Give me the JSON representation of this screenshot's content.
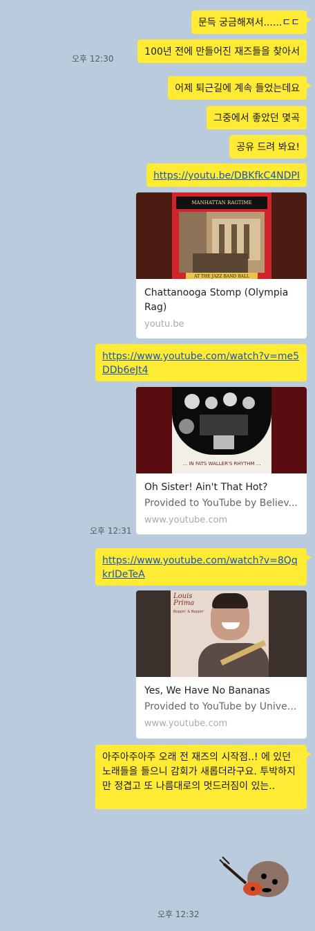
{
  "messages": {
    "m1": "문득 궁금해져서......ㄷㄷ",
    "m2": "100년 전에 만들어진 재즈들을 찾아서",
    "m3": "어제 퇴근길에 계속 들었는데요",
    "m4": "그중에서 좋았던 몇곡",
    "m5": "공유 드려 봐요!",
    "link1": "https://youtu.be/DBKfkC4NDPI",
    "link2": "https://www.youtube.com/watch?v=me5DDb6eJt4",
    "link3": "https://www.youtube.com/watch?v=8QqkrIDeTeA",
    "final": "아주아주아주 오래 전 재즈의 시작점..! 에 있던 노래들을 들으니 감회가 새롭더라구요. 투박하지만 정겹고 또 나름대로의 멋드러짐이 있는.."
  },
  "times": {
    "t1": "오후 12:30",
    "t2": "오후 12:31",
    "t3": "오후 12:32"
  },
  "cards": [
    {
      "thumb_text_top": "MANHATTAN RAGTIME ORCHESTRA",
      "thumb_text_bottom": "AT THE JAZZ BAND BALL",
      "title": "Chattanooga Stomp (Olympia Rag)",
      "domain": "youtu.be"
    },
    {
      "thumb_text": "... IN FATS WALLER'S RHYTHM ...",
      "title": "Oh Sister! Ain't That Hot?",
      "desc": "Provided to YouTube by Believ...",
      "domain": "www.youtube.com"
    },
    {
      "thumb_text_top": "Louis Prima",
      "thumb_text_sub": "Boppin' & Boppin'",
      "title": "Yes, We Have No Bananas",
      "desc": "Provided to YouTube by Univer...",
      "domain": "www.youtube.com"
    }
  ],
  "colors": {
    "background": "#b9cbdc",
    "bubble": "#ffeb33",
    "link": "#1a55b5"
  }
}
